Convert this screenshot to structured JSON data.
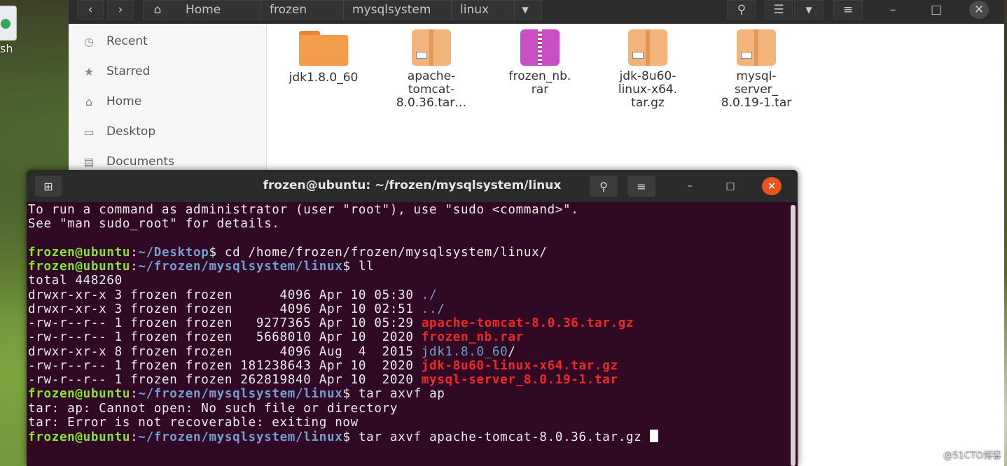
{
  "desktop": {
    "trash_label": "sh"
  },
  "file_manager": {
    "breadcrumbs": [
      "Home",
      "frozen",
      "mysqlsystem",
      "linux"
    ],
    "sidebar": [
      {
        "label": "Recent",
        "icon": "clock-icon"
      },
      {
        "label": "Starred",
        "icon": "star-icon"
      },
      {
        "label": "Home",
        "icon": "home-icon"
      },
      {
        "label": "Desktop",
        "icon": "desktop-icon"
      },
      {
        "label": "Documents",
        "icon": "documents-icon"
      }
    ],
    "files": [
      {
        "name": "jdk1.8.0_60",
        "type": "folder"
      },
      {
        "name": "apache-\ntomcat-\n8.0.36.tar…",
        "type": "archive"
      },
      {
        "name": "frozen_nb.\nrar",
        "type": "rar"
      },
      {
        "name": "jdk-8u60-\nlinux-x64.\ntar.gz",
        "type": "archive"
      },
      {
        "name": "mysql-\nserver_\n8.0.19-1.tar",
        "type": "archive"
      }
    ]
  },
  "terminal": {
    "title": "frozen@ubuntu: ~/frozen/mysqlsystem/linux",
    "lines": [
      [
        {
          "t": "To run a command as administrator (user \"root\"), use \"sudo <command>\".",
          "c": ""
        }
      ],
      [
        {
          "t": "See \"man sudo_root\" for details.",
          "c": ""
        }
      ],
      [
        {
          "t": "",
          "c": ""
        }
      ],
      [
        {
          "t": "frozen@ubuntu",
          "c": "pu"
        },
        {
          "t": ":",
          "c": ""
        },
        {
          "t": "~/Desktop",
          "c": "pp"
        },
        {
          "t": "$ cd /home/frozen/frozen/mysqlsystem/linux/",
          "c": ""
        }
      ],
      [
        {
          "t": "frozen@ubuntu",
          "c": "pu"
        },
        {
          "t": ":",
          "c": ""
        },
        {
          "t": "~/frozen/mysqlsystem/linux",
          "c": "pp"
        },
        {
          "t": "$ ll",
          "c": ""
        }
      ],
      [
        {
          "t": "total 448260",
          "c": ""
        }
      ],
      [
        {
          "t": "drwxr-xr-x 3 frozen frozen      4096 Apr 10 05:30 ",
          "c": ""
        },
        {
          "t": "./",
          "c": "dir"
        }
      ],
      [
        {
          "t": "drwxr-xr-x 3 frozen frozen      4096 Apr 10 02:51 ",
          "c": ""
        },
        {
          "t": "../",
          "c": "dir"
        }
      ],
      [
        {
          "t": "-rw-r--r-- 1 frozen frozen   9277365 Apr 10 05:29 ",
          "c": ""
        },
        {
          "t": "apache-tomcat-8.0.36.tar.gz",
          "c": "arc"
        }
      ],
      [
        {
          "t": "-rw-r--r-- 1 frozen frozen   5668010 Apr 10  2020 ",
          "c": ""
        },
        {
          "t": "frozen_nb.rar",
          "c": "arc"
        }
      ],
      [
        {
          "t": "drwxr-xr-x 8 frozen frozen      4096 Aug  4  2015 ",
          "c": ""
        },
        {
          "t": "jdk1.8.0_60",
          "c": "dir"
        },
        {
          "t": "/",
          "c": ""
        }
      ],
      [
        {
          "t": "-rw-r--r-- 1 frozen frozen 181238643 Apr 10  2020 ",
          "c": ""
        },
        {
          "t": "jdk-8u60-linux-x64.tar.gz",
          "c": "arc"
        }
      ],
      [
        {
          "t": "-rw-r--r-- 1 frozen frozen 262819840 Apr 10  2020 ",
          "c": ""
        },
        {
          "t": "mysql-server_8.0.19-1.tar",
          "c": "arc"
        }
      ],
      [
        {
          "t": "frozen@ubuntu",
          "c": "pu"
        },
        {
          "t": ":",
          "c": ""
        },
        {
          "t": "~/frozen/mysqlsystem/linux",
          "c": "pp"
        },
        {
          "t": "$ tar axvf ap",
          "c": ""
        }
      ],
      [
        {
          "t": "tar: ap: Cannot open: No such file or directory",
          "c": ""
        }
      ],
      [
        {
          "t": "tar: Error is not recoverable: exiting now",
          "c": ""
        }
      ],
      [
        {
          "t": "frozen@ubuntu",
          "c": "pu"
        },
        {
          "t": ":",
          "c": ""
        },
        {
          "t": "~/frozen/mysqlsystem/linux",
          "c": "pp"
        },
        {
          "t": "$ tar axvf apache-tomcat-8.0.36.tar.gz ",
          "c": ""
        },
        {
          "t": "",
          "c": "cursor"
        }
      ]
    ]
  },
  "watermark": "@51CTO博客"
}
